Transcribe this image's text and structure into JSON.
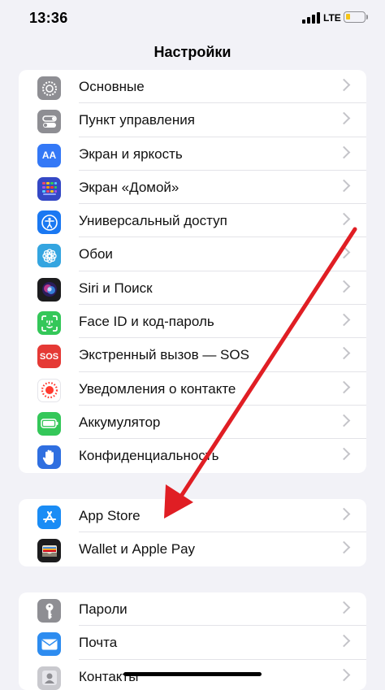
{
  "status": {
    "time": "13:36",
    "network": "LTE"
  },
  "nav": {
    "title": "Настройки"
  },
  "group1": [
    {
      "label": "Основные",
      "icon": "gear-icon",
      "color": "#8e8e93"
    },
    {
      "label": "Пункт управления",
      "icon": "toggles-icon",
      "color": "#8e8e93"
    },
    {
      "label": "Экран и яркость",
      "icon": "text-size-icon",
      "color": "#3478f6"
    },
    {
      "label": "Экран «Домой»",
      "icon": "home-grid-icon",
      "color": "#3448c5"
    },
    {
      "label": "Универсальный доступ",
      "icon": "accessibility-icon",
      "color": "#1a78f2"
    },
    {
      "label": "Обои",
      "icon": "wallpaper-flower-icon",
      "color": "#34a5e0"
    },
    {
      "label": "Siri и Поиск",
      "icon": "siri-icon",
      "color": "#1c1c1e"
    },
    {
      "label": "Face ID и код-пароль",
      "icon": "face-id-icon",
      "color": "#34c759"
    },
    {
      "label": "Экстренный вызов — SOS",
      "icon": "sos-icon",
      "color": "#e53935",
      "icon_text": "SOS"
    },
    {
      "label": "Уведомления о контакте",
      "icon": "exposure-notification-icon",
      "color": "#ffffff"
    },
    {
      "label": "Аккумулятор",
      "icon": "battery-icon",
      "color": "#34c759"
    },
    {
      "label": "Конфиденциальность",
      "icon": "privacy-hand-icon",
      "color": "#2f6fe0"
    }
  ],
  "group2": [
    {
      "label": "App Store",
      "icon": "app-store-icon",
      "color": "#1a8cf5"
    },
    {
      "label": "Wallet и Apple Pay",
      "icon": "wallet-icon",
      "color": "#1c1c1e"
    }
  ],
  "group3": [
    {
      "label": "Пароли",
      "icon": "key-icon",
      "color": "#8e8e93"
    },
    {
      "label": "Почта",
      "icon": "mail-icon",
      "color": "#2d8cf0"
    },
    {
      "label": "Контакты",
      "icon": "contacts-icon",
      "color": "#a8a8ad"
    }
  ],
  "accent_colors": {
    "arrow": "#e01e24",
    "chevron": "#c4c4c9"
  }
}
